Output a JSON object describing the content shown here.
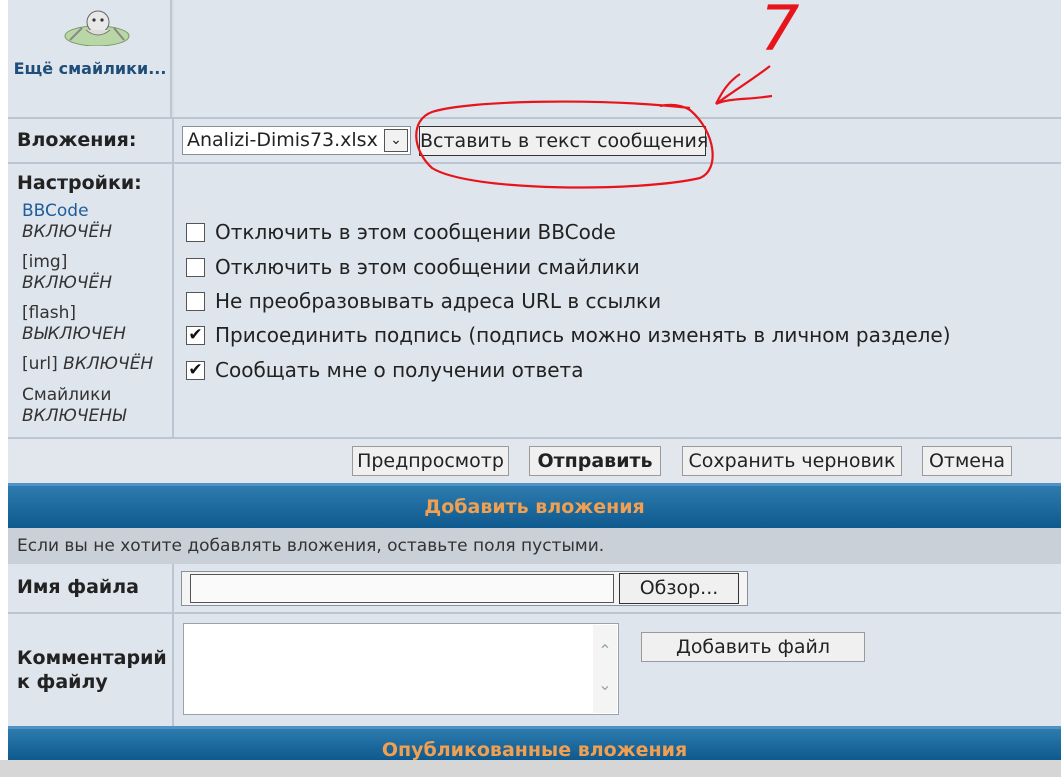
{
  "smilies": {
    "more_label": "Ещё смайлики..."
  },
  "attachments": {
    "label": "Вложения:",
    "selected_file": "Analizi-Dimis73.xlsx",
    "insert_button": "Вставить в текст сообщения"
  },
  "settings": {
    "label": "Настройки:",
    "items": [
      {
        "name": "BBCode",
        "state": "ВКЛЮЧЁН"
      },
      {
        "name": "[img]",
        "state": "ВКЛЮЧЁН"
      },
      {
        "name": "[flash]",
        "state": "ВЫКЛЮЧЕН"
      },
      {
        "name": "[url]",
        "state": "ВКЛЮЧЁН"
      },
      {
        "name": "Смайлики",
        "state": "ВКЛЮЧЕНЫ"
      }
    ]
  },
  "options": [
    {
      "label": "Отключить в этом сообщении BBCode",
      "checked": false
    },
    {
      "label": "Отключить в этом сообщении смайлики",
      "checked": false
    },
    {
      "label": "Не преобразовывать адреса URL в ссылки",
      "checked": false
    },
    {
      "label": "Присоединить подпись (подпись можно изменять в личном разделе)",
      "checked": true
    },
    {
      "label": "Сообщать мне о получении ответа",
      "checked": true
    }
  ],
  "actions": {
    "preview": "Предпросмотр",
    "submit": "Отправить",
    "save_draft": "Сохранить черновик",
    "cancel": "Отмена"
  },
  "add_attachments": {
    "title": "Добавить вложения",
    "hint": "Если вы не хотите добавлять вложения, оставьте поля пустыми.",
    "filename_label": "Имя файла",
    "browse_button": "Обзор...",
    "comment_label": "Комментарий к файлу",
    "add_button": "Добавить файл"
  },
  "published": {
    "title": "Опубликованные вложения"
  },
  "annotation": {
    "mark": "7",
    "color": "#e8141b"
  }
}
